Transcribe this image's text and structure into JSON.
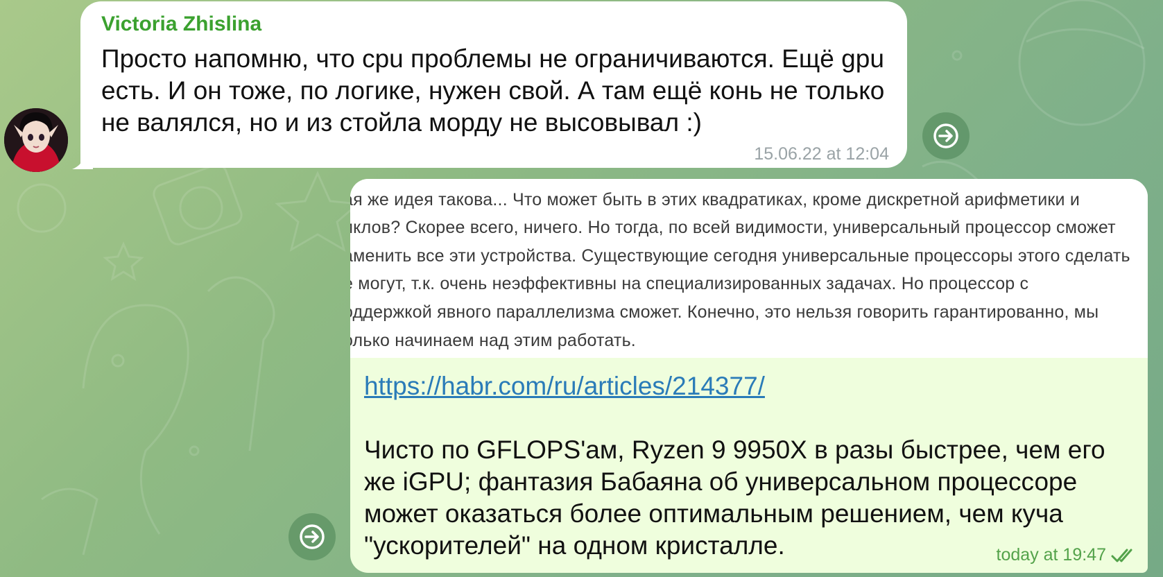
{
  "incoming": {
    "sender": "Victoria Zhislina",
    "text": "Просто напомню, что cpu проблемы не ограничиваются. Ещё gpu есть. И он тоже, по логике, нужен свой. А там ещё конь не только не валялся, но и из стойла морду не высовывал :)",
    "time": "15.06.22 at 12:04",
    "avatar_icon": "anime-girl-avatar"
  },
  "outgoing": {
    "quote_lines": [
      "ая же идея такова... Что может быть в этих квадратиках, кроме дискретной арифметики и",
      "иклов? Скорее всего, ничего. Но тогда, по всей видимости, универсальный процессор сможет",
      "аменить все эти устройства. Существующие сегодня универсальные процессоры этого сделать",
      "е могут, т.к. очень неэффективны на специализированных задачах. Но процессор с",
      "оддержкой явного параллелизма сможет. Конечно, это нельзя говорить гарантированно, мы",
      "олько начинаем над этим работать."
    ],
    "link": "https://habr.com/ru/articles/214377/",
    "text": "Чисто по GFLOPS'ам, Ryzen 9 9950X в разы быстрее, чем его же iGPU; фантазия Бабаяна об универсальном процессоре может оказаться более оптимальным решением, чем куча \"ускорителей\" на одном кристалле.",
    "time": "today at 19:47",
    "status_icon": "double-check-icon"
  },
  "colors": {
    "sender_name": "#3ba12f",
    "link": "#2a7bb8",
    "outgoing_bubble": "#effedd",
    "outgoing_time": "#53a24a"
  }
}
